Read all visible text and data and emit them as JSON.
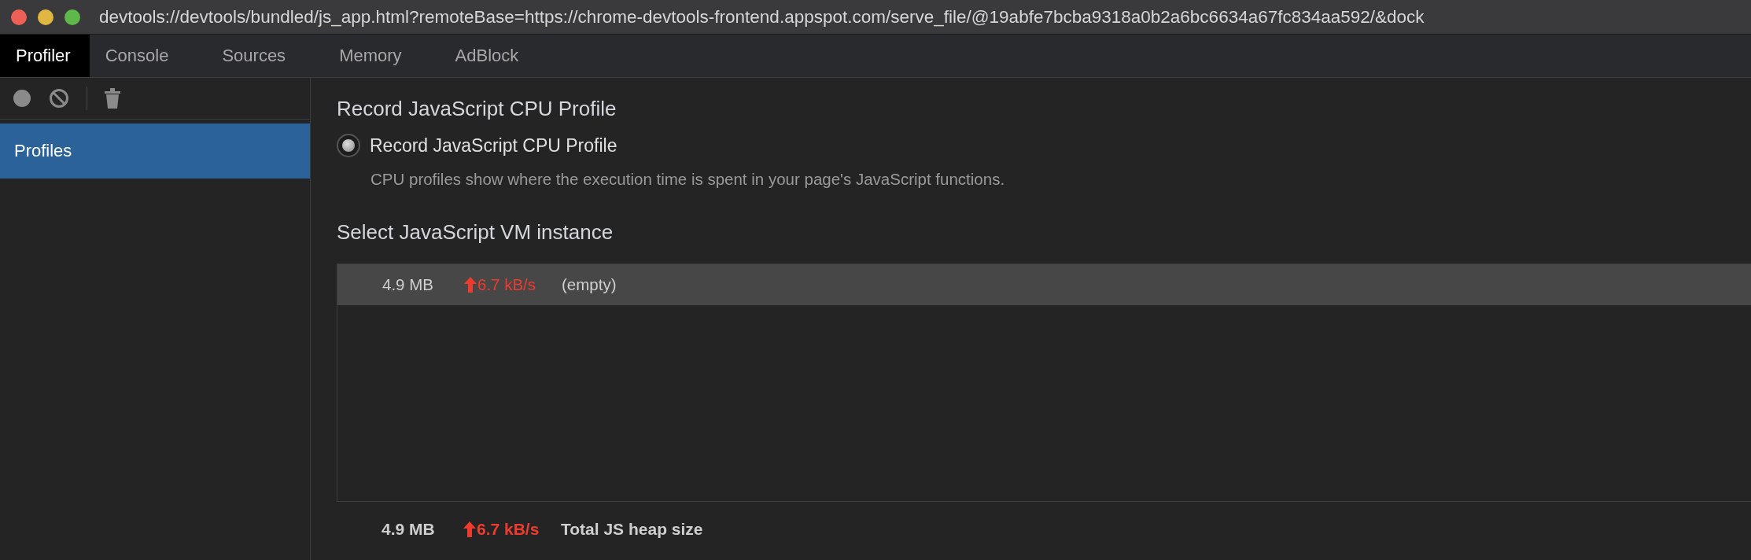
{
  "window": {
    "title": "devtools://devtools/bundled/js_app.html?remoteBase=https://chrome-devtools-frontend.appspot.com/serve_file/@19abfe7bcba9318a0b2a6bc6634a67fc834aa592/&dock"
  },
  "tabs": [
    {
      "label": "Profiler",
      "selected": true
    },
    {
      "label": "Console",
      "selected": false
    },
    {
      "label": "Sources",
      "selected": false
    },
    {
      "label": "Memory",
      "selected": false
    },
    {
      "label": "AdBlock",
      "selected": false
    }
  ],
  "sidebar": {
    "items": [
      {
        "label": "Profiles",
        "selected": true
      }
    ]
  },
  "content": {
    "heading": "Record JavaScript CPU Profile",
    "profile_types": [
      {
        "label": "Record JavaScript CPU Profile",
        "description": "CPU profiles show where the execution time is spent in your page's JavaScript functions.",
        "selected": true
      }
    ],
    "vm_section": {
      "heading": "Select JavaScript VM instance",
      "instances": [
        {
          "size": "4.9 MB",
          "rate": "6.7 kB/s",
          "name": "(empty)",
          "selected": true
        }
      ]
    },
    "footer": {
      "size": "4.9 MB",
      "rate": "6.7 kB/s",
      "label": "Total JS heap size"
    }
  }
}
